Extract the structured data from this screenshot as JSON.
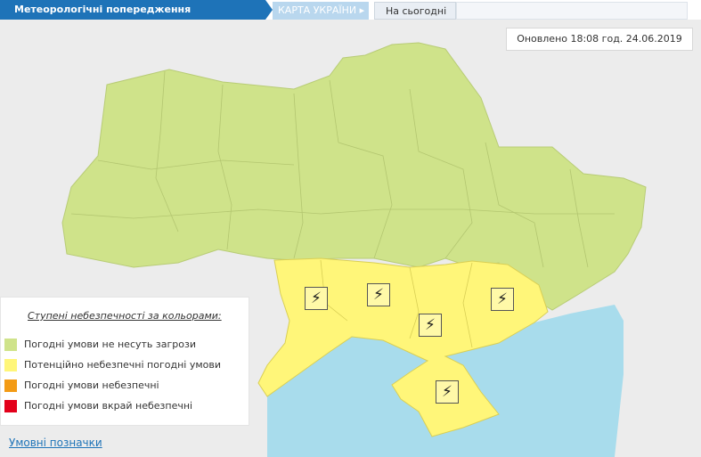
{
  "header": {
    "active_tab": "Метеорологічні попередження",
    "map_tab": "КАРТА УКРАЇНИ",
    "map_tab_arrow": "▸",
    "today_tab": "На сьогодні"
  },
  "updated_text": "Оновлено 18:08 год. 24.06.2019",
  "legend": {
    "title": "Ступені небезпечності за кольорами:",
    "items": [
      {
        "label": "Погодні умови не несуть загрози",
        "color": "#cfe38a"
      },
      {
        "label": "Потенційно небезпечні погодні умови",
        "color": "#fff679"
      },
      {
        "label": "Погодні умови небезпечні",
        "color": "#f39b15"
      },
      {
        "label": "Погодні умови вкрай небезпечні",
        "color": "#e3001b"
      }
    ]
  },
  "notations_link": "Умовні позначки",
  "map": {
    "sea_color": "#a8dcec",
    "safe_color": "#cfe38a",
    "warning_color": "#fff679",
    "warning_icon": "⚡",
    "warning_icon_name": "lightning-icon"
  }
}
